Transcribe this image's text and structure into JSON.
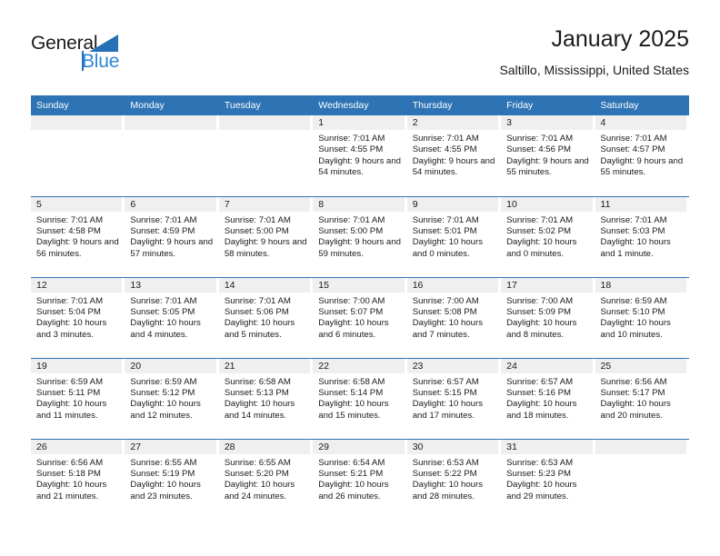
{
  "brand": {
    "line1": "General",
    "line2": "Blue",
    "triangle_icon": "triangle-icon",
    "accent_color": "#2e74b5"
  },
  "header": {
    "title": "January 2025",
    "subtitle": "Saltillo, Mississippi, United States"
  },
  "calendar": {
    "weekday_headers": [
      "Sunday",
      "Monday",
      "Tuesday",
      "Wednesday",
      "Thursday",
      "Friday",
      "Saturday"
    ],
    "header_bg": "#2e74b5",
    "daynum_bg": "#efefef",
    "weeks": [
      [
        {
          "day": "",
          "lines": []
        },
        {
          "day": "",
          "lines": []
        },
        {
          "day": "",
          "lines": []
        },
        {
          "day": "1",
          "lines": [
            "Sunrise: 7:01 AM",
            "Sunset: 4:55 PM",
            "Daylight: 9 hours and 54 minutes."
          ]
        },
        {
          "day": "2",
          "lines": [
            "Sunrise: 7:01 AM",
            "Sunset: 4:55 PM",
            "Daylight: 9 hours and 54 minutes."
          ]
        },
        {
          "day": "3",
          "lines": [
            "Sunrise: 7:01 AM",
            "Sunset: 4:56 PM",
            "Daylight: 9 hours and 55 minutes."
          ]
        },
        {
          "day": "4",
          "lines": [
            "Sunrise: 7:01 AM",
            "Sunset: 4:57 PM",
            "Daylight: 9 hours and 55 minutes."
          ]
        }
      ],
      [
        {
          "day": "5",
          "lines": [
            "Sunrise: 7:01 AM",
            "Sunset: 4:58 PM",
            "Daylight: 9 hours and 56 minutes."
          ]
        },
        {
          "day": "6",
          "lines": [
            "Sunrise: 7:01 AM",
            "Sunset: 4:59 PM",
            "Daylight: 9 hours and 57 minutes."
          ]
        },
        {
          "day": "7",
          "lines": [
            "Sunrise: 7:01 AM",
            "Sunset: 5:00 PM",
            "Daylight: 9 hours and 58 minutes."
          ]
        },
        {
          "day": "8",
          "lines": [
            "Sunrise: 7:01 AM",
            "Sunset: 5:00 PM",
            "Daylight: 9 hours and 59 minutes."
          ]
        },
        {
          "day": "9",
          "lines": [
            "Sunrise: 7:01 AM",
            "Sunset: 5:01 PM",
            "Daylight: 10 hours and 0 minutes."
          ]
        },
        {
          "day": "10",
          "lines": [
            "Sunrise: 7:01 AM",
            "Sunset: 5:02 PM",
            "Daylight: 10 hours and 0 minutes."
          ]
        },
        {
          "day": "11",
          "lines": [
            "Sunrise: 7:01 AM",
            "Sunset: 5:03 PM",
            "Daylight: 10 hours and 1 minute."
          ]
        }
      ],
      [
        {
          "day": "12",
          "lines": [
            "Sunrise: 7:01 AM",
            "Sunset: 5:04 PM",
            "Daylight: 10 hours and 3 minutes."
          ]
        },
        {
          "day": "13",
          "lines": [
            "Sunrise: 7:01 AM",
            "Sunset: 5:05 PM",
            "Daylight: 10 hours and 4 minutes."
          ]
        },
        {
          "day": "14",
          "lines": [
            "Sunrise: 7:01 AM",
            "Sunset: 5:06 PM",
            "Daylight: 10 hours and 5 minutes."
          ]
        },
        {
          "day": "15",
          "lines": [
            "Sunrise: 7:00 AM",
            "Sunset: 5:07 PM",
            "Daylight: 10 hours and 6 minutes."
          ]
        },
        {
          "day": "16",
          "lines": [
            "Sunrise: 7:00 AM",
            "Sunset: 5:08 PM",
            "Daylight: 10 hours and 7 minutes."
          ]
        },
        {
          "day": "17",
          "lines": [
            "Sunrise: 7:00 AM",
            "Sunset: 5:09 PM",
            "Daylight: 10 hours and 8 minutes."
          ]
        },
        {
          "day": "18",
          "lines": [
            "Sunrise: 6:59 AM",
            "Sunset: 5:10 PM",
            "Daylight: 10 hours and 10 minutes."
          ]
        }
      ],
      [
        {
          "day": "19",
          "lines": [
            "Sunrise: 6:59 AM",
            "Sunset: 5:11 PM",
            "Daylight: 10 hours and 11 minutes."
          ]
        },
        {
          "day": "20",
          "lines": [
            "Sunrise: 6:59 AM",
            "Sunset: 5:12 PM",
            "Daylight: 10 hours and 12 minutes."
          ]
        },
        {
          "day": "21",
          "lines": [
            "Sunrise: 6:58 AM",
            "Sunset: 5:13 PM",
            "Daylight: 10 hours and 14 minutes."
          ]
        },
        {
          "day": "22",
          "lines": [
            "Sunrise: 6:58 AM",
            "Sunset: 5:14 PM",
            "Daylight: 10 hours and 15 minutes."
          ]
        },
        {
          "day": "23",
          "lines": [
            "Sunrise: 6:57 AM",
            "Sunset: 5:15 PM",
            "Daylight: 10 hours and 17 minutes."
          ]
        },
        {
          "day": "24",
          "lines": [
            "Sunrise: 6:57 AM",
            "Sunset: 5:16 PM",
            "Daylight: 10 hours and 18 minutes."
          ]
        },
        {
          "day": "25",
          "lines": [
            "Sunrise: 6:56 AM",
            "Sunset: 5:17 PM",
            "Daylight: 10 hours and 20 minutes."
          ]
        }
      ],
      [
        {
          "day": "26",
          "lines": [
            "Sunrise: 6:56 AM",
            "Sunset: 5:18 PM",
            "Daylight: 10 hours and 21 minutes."
          ]
        },
        {
          "day": "27",
          "lines": [
            "Sunrise: 6:55 AM",
            "Sunset: 5:19 PM",
            "Daylight: 10 hours and 23 minutes."
          ]
        },
        {
          "day": "28",
          "lines": [
            "Sunrise: 6:55 AM",
            "Sunset: 5:20 PM",
            "Daylight: 10 hours and 24 minutes."
          ]
        },
        {
          "day": "29",
          "lines": [
            "Sunrise: 6:54 AM",
            "Sunset: 5:21 PM",
            "Daylight: 10 hours and 26 minutes."
          ]
        },
        {
          "day": "30",
          "lines": [
            "Sunrise: 6:53 AM",
            "Sunset: 5:22 PM",
            "Daylight: 10 hours and 28 minutes."
          ]
        },
        {
          "day": "31",
          "lines": [
            "Sunrise: 6:53 AM",
            "Sunset: 5:23 PM",
            "Daylight: 10 hours and 29 minutes."
          ]
        },
        {
          "day": "",
          "lines": []
        }
      ]
    ]
  }
}
